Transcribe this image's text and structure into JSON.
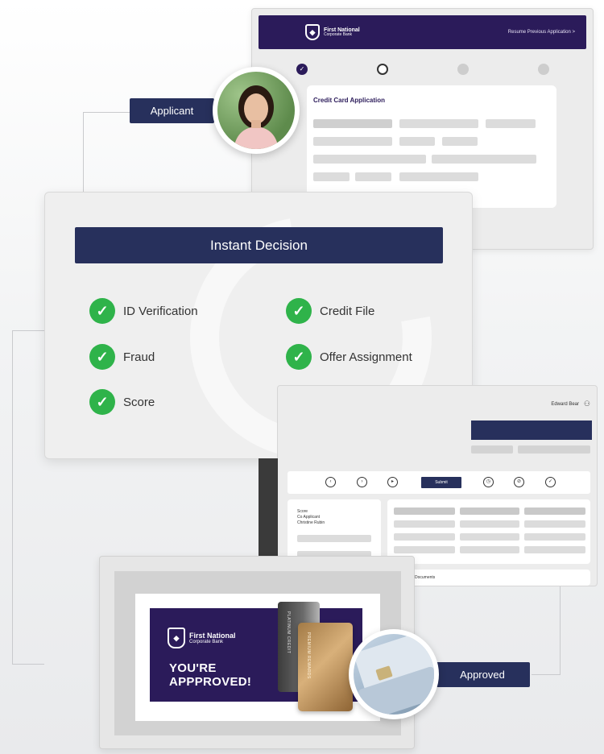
{
  "application": {
    "bank_name_line1": "First National",
    "bank_name_line2": "Corporate Bank",
    "resume_link": "Resume Previous Application  >",
    "form_title": "Credit Card Application",
    "steps": [
      "done",
      "current",
      "todo",
      "todo"
    ]
  },
  "applicant_tag": "Applicant",
  "decision": {
    "title": "Instant Decision",
    "items": [
      {
        "label": "ID Verification"
      },
      {
        "label": "Credit File"
      },
      {
        "label": "Fraud"
      },
      {
        "label": "Offer Assignment"
      },
      {
        "label": "Score"
      }
    ]
  },
  "dashboard": {
    "user_name": "Edward Bear",
    "submit_label": "Submit",
    "score_lines": [
      "Score",
      "Co Applicant",
      "Christine Rubin"
    ],
    "documents_label": "Documents"
  },
  "approved": {
    "bank_name_line1": "First National",
    "bank_name_line2": "Corporate Bank",
    "line1": "YOU'RE",
    "line2": "APPPROVED!",
    "silver_card_label": "PLATINUM CREDIT",
    "gold_card_label": "PREMIUM REWARDS"
  },
  "approved_tag": "Approved",
  "colors": {
    "navy": "#27305c",
    "purple": "#2b1b5a",
    "check_green": "#2fb34a"
  }
}
